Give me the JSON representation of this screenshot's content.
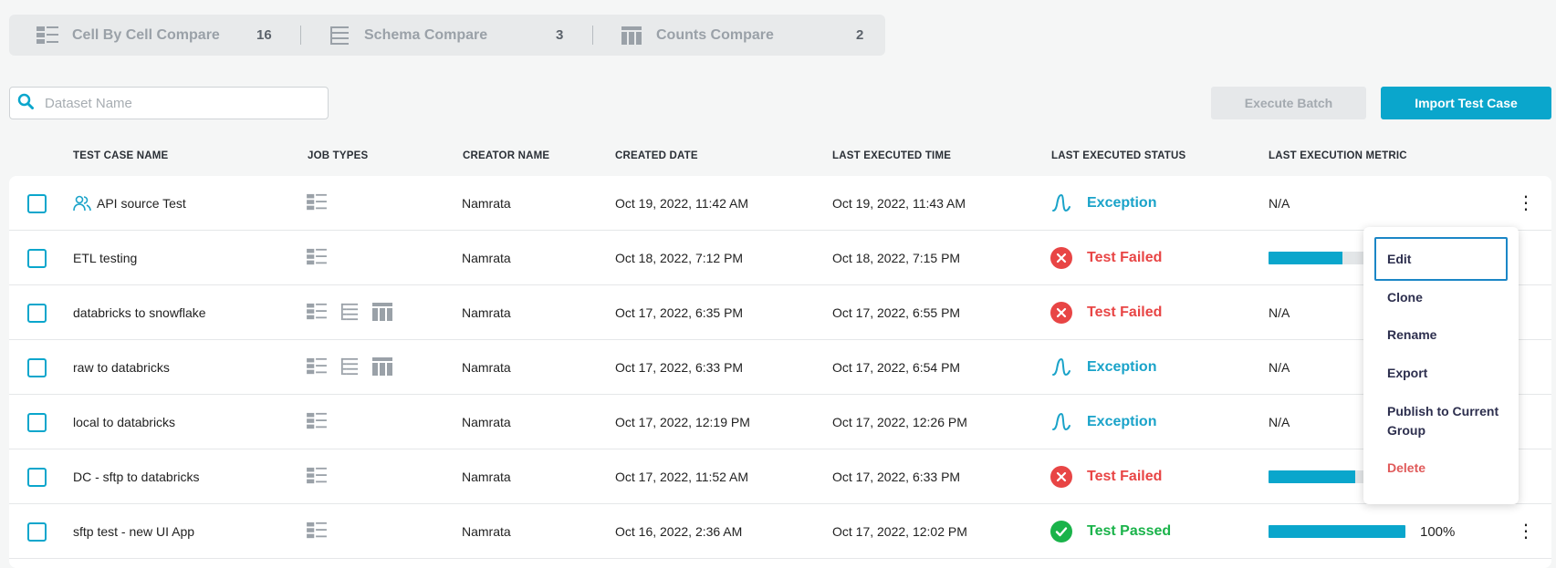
{
  "tabs": [
    {
      "label": "Cell By Cell Compare",
      "count": "16",
      "icon": "cell-compare-icon"
    },
    {
      "label": "Schema Compare",
      "count": "3",
      "icon": "schema-compare-icon"
    },
    {
      "label": "Counts Compare",
      "count": "2",
      "icon": "counts-compare-icon"
    }
  ],
  "search": {
    "placeholder": "Dataset Name"
  },
  "buttons": {
    "execute_batch": "Execute Batch",
    "import_test_case": "Import Test Case"
  },
  "columns": [
    "TEST CASE NAME",
    "JOB TYPES",
    "CREATOR NAME",
    "CREATED DATE",
    "LAST EXECUTED TIME",
    "LAST EXECUTED STATUS",
    "LAST EXECUTION METRIC"
  ],
  "rows": [
    {
      "name": "API source Test",
      "shared": true,
      "job_types": [
        "cell"
      ],
      "creator": "Namrata",
      "created": "Oct 19, 2022, 11:42 AM",
      "executed": "Oct 19, 2022, 11:43 AM",
      "status": "Exception",
      "metric": "N/A"
    },
    {
      "name": "ETL testing",
      "shared": false,
      "job_types": [
        "cell"
      ],
      "creator": "Namrata",
      "created": "Oct 18, 2022, 7:12 PM",
      "executed": "Oct 18, 2022, 7:15 PM",
      "status": "Test Failed",
      "metric_progress": 0.54
    },
    {
      "name": "databricks to snowflake",
      "shared": false,
      "job_types": [
        "cell",
        "schema",
        "counts"
      ],
      "creator": "Namrata",
      "created": "Oct 17, 2022, 6:35 PM",
      "executed": "Oct 17, 2022, 6:55 PM",
      "status": "Test Failed",
      "metric": "N/A"
    },
    {
      "name": "raw to databricks",
      "shared": false,
      "job_types": [
        "cell",
        "schema",
        "counts"
      ],
      "creator": "Namrata",
      "created": "Oct 17, 2022, 6:33 PM",
      "executed": "Oct 17, 2022, 6:54 PM",
      "status": "Exception",
      "metric": "N/A"
    },
    {
      "name": "local to databricks",
      "shared": false,
      "job_types": [
        "cell"
      ],
      "creator": "Namrata",
      "created": "Oct 17, 2022, 12:19 PM",
      "executed": "Oct 17, 2022, 12:26 PM",
      "status": "Exception",
      "metric": "N/A"
    },
    {
      "name": "DC - sftp to databricks",
      "shared": false,
      "job_types": [
        "cell"
      ],
      "creator": "Namrata",
      "created": "Oct 17, 2022, 11:52 AM",
      "executed": "Oct 17, 2022, 6:33 PM",
      "status": "Test Failed",
      "metric_progress": 0.63
    },
    {
      "name": "sftp test - new UI App",
      "shared": false,
      "job_types": [
        "cell"
      ],
      "creator": "Namrata",
      "created": "Oct 16, 2022, 2:36 AM",
      "executed": "Oct 17, 2022, 12:02 PM",
      "status": "Test Passed",
      "metric_progress": 1.0,
      "metric_text": "100%"
    }
  ],
  "status_colors": {
    "Exception": "#1aa3c9",
    "Test Failed": "#e84545",
    "Test Passed": "#1ab34a"
  },
  "context_menu": {
    "items": [
      "Edit",
      "Clone",
      "Rename",
      "Export",
      "Publish to Current Group",
      "Delete"
    ],
    "selected": "Edit"
  }
}
